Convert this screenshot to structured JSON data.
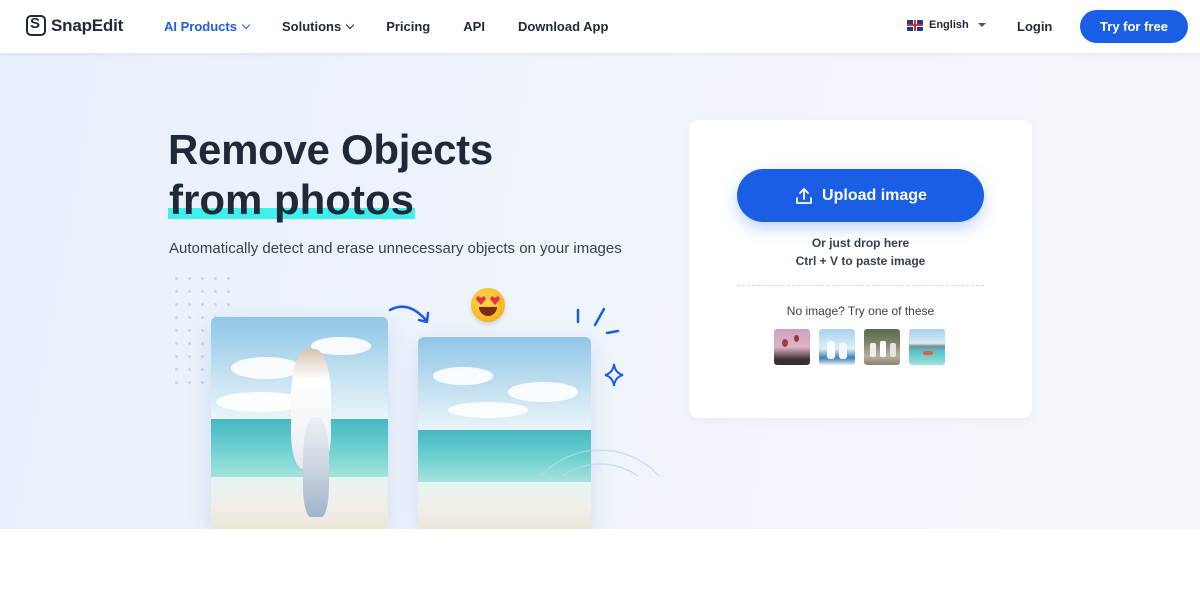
{
  "brand": {
    "name": "SnapEdit"
  },
  "nav": {
    "items": [
      {
        "label": "AI Products",
        "dropdown": true,
        "active": true
      },
      {
        "label": "Solutions",
        "dropdown": true,
        "active": false
      },
      {
        "label": "Pricing",
        "dropdown": false,
        "active": false
      },
      {
        "label": "API",
        "dropdown": false,
        "active": false
      },
      {
        "label": "Download App",
        "dropdown": false,
        "active": false
      }
    ]
  },
  "header": {
    "language": "English",
    "language_flag_icon": "uk-flag-icon",
    "login_label": "Login",
    "cta_label": "Try for free"
  },
  "hero": {
    "title_line1": "Remove Objects",
    "title_line2": "from photos",
    "subtitle": "Automatically detect and erase unnecessary objects on your images"
  },
  "upload": {
    "button_label": "Upload image",
    "button_icon": "upload-icon",
    "drop_hint": "Or just drop here",
    "paste_hint": "Ctrl + V to paste image",
    "sample_prompt": "No image? Try one of these",
    "samples": [
      "sample-image-1",
      "sample-image-2",
      "sample-image-3",
      "sample-image-4"
    ]
  },
  "colors": {
    "accent": "#1a5ee6",
    "highlight": "#3ef0ec",
    "text_dark": "#1f2937",
    "hero_bg": "#eef3fb"
  }
}
